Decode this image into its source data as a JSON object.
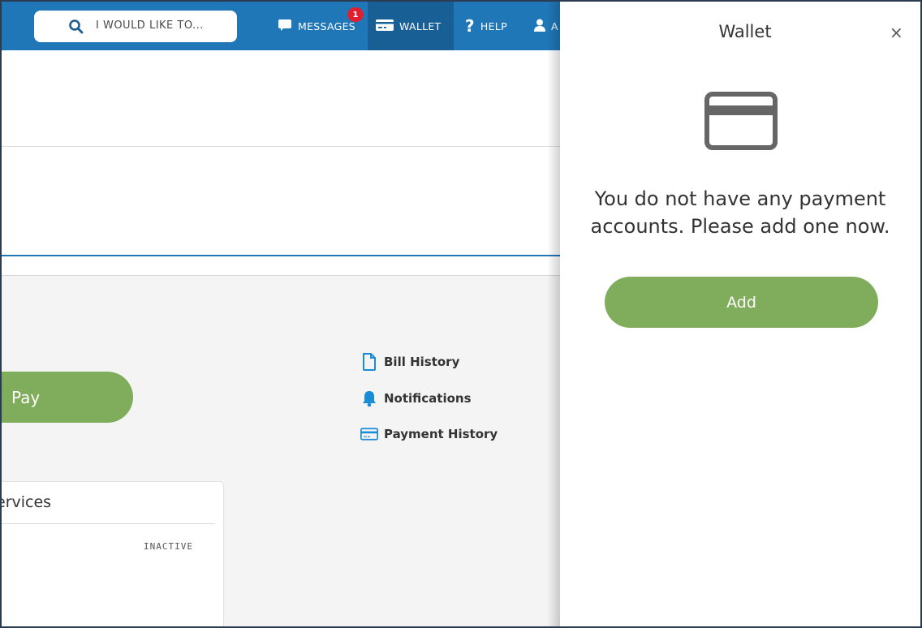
{
  "header": {
    "search_label": "I WOULD LIKE TO...",
    "nav": {
      "messages": "MESSAGES",
      "messages_badge": "1",
      "wallet": "WALLET",
      "help": "HELP",
      "account_initial": "A"
    }
  },
  "main": {
    "pay_label": "Pay",
    "quick_links": {
      "bill_history": "Bill History",
      "notifications": "Notifications",
      "payment_history": "Payment History"
    },
    "services": {
      "title": "ervices",
      "status": "INACTIVE"
    }
  },
  "wallet_panel": {
    "title": "Wallet",
    "close_glyph": "×",
    "message": "You do not have any payment accounts. Please add one now.",
    "add_label": "Add"
  },
  "colors": {
    "nav_blue": "#1f77b7",
    "nav_active": "#185f95",
    "button_green": "#80ad5c",
    "badge_red": "#e0202e",
    "link_icon_blue": "#1a8bd6"
  },
  "icons": {
    "search": "search-icon",
    "messages": "chat-bubble-icon",
    "wallet": "credit-card-icon",
    "help": "question-mark-icon",
    "account": "user-icon",
    "bill_history": "document-icon",
    "notifications": "bell-icon",
    "payment_history": "credit-card-icon",
    "wallet_empty": "credit-card-icon"
  }
}
